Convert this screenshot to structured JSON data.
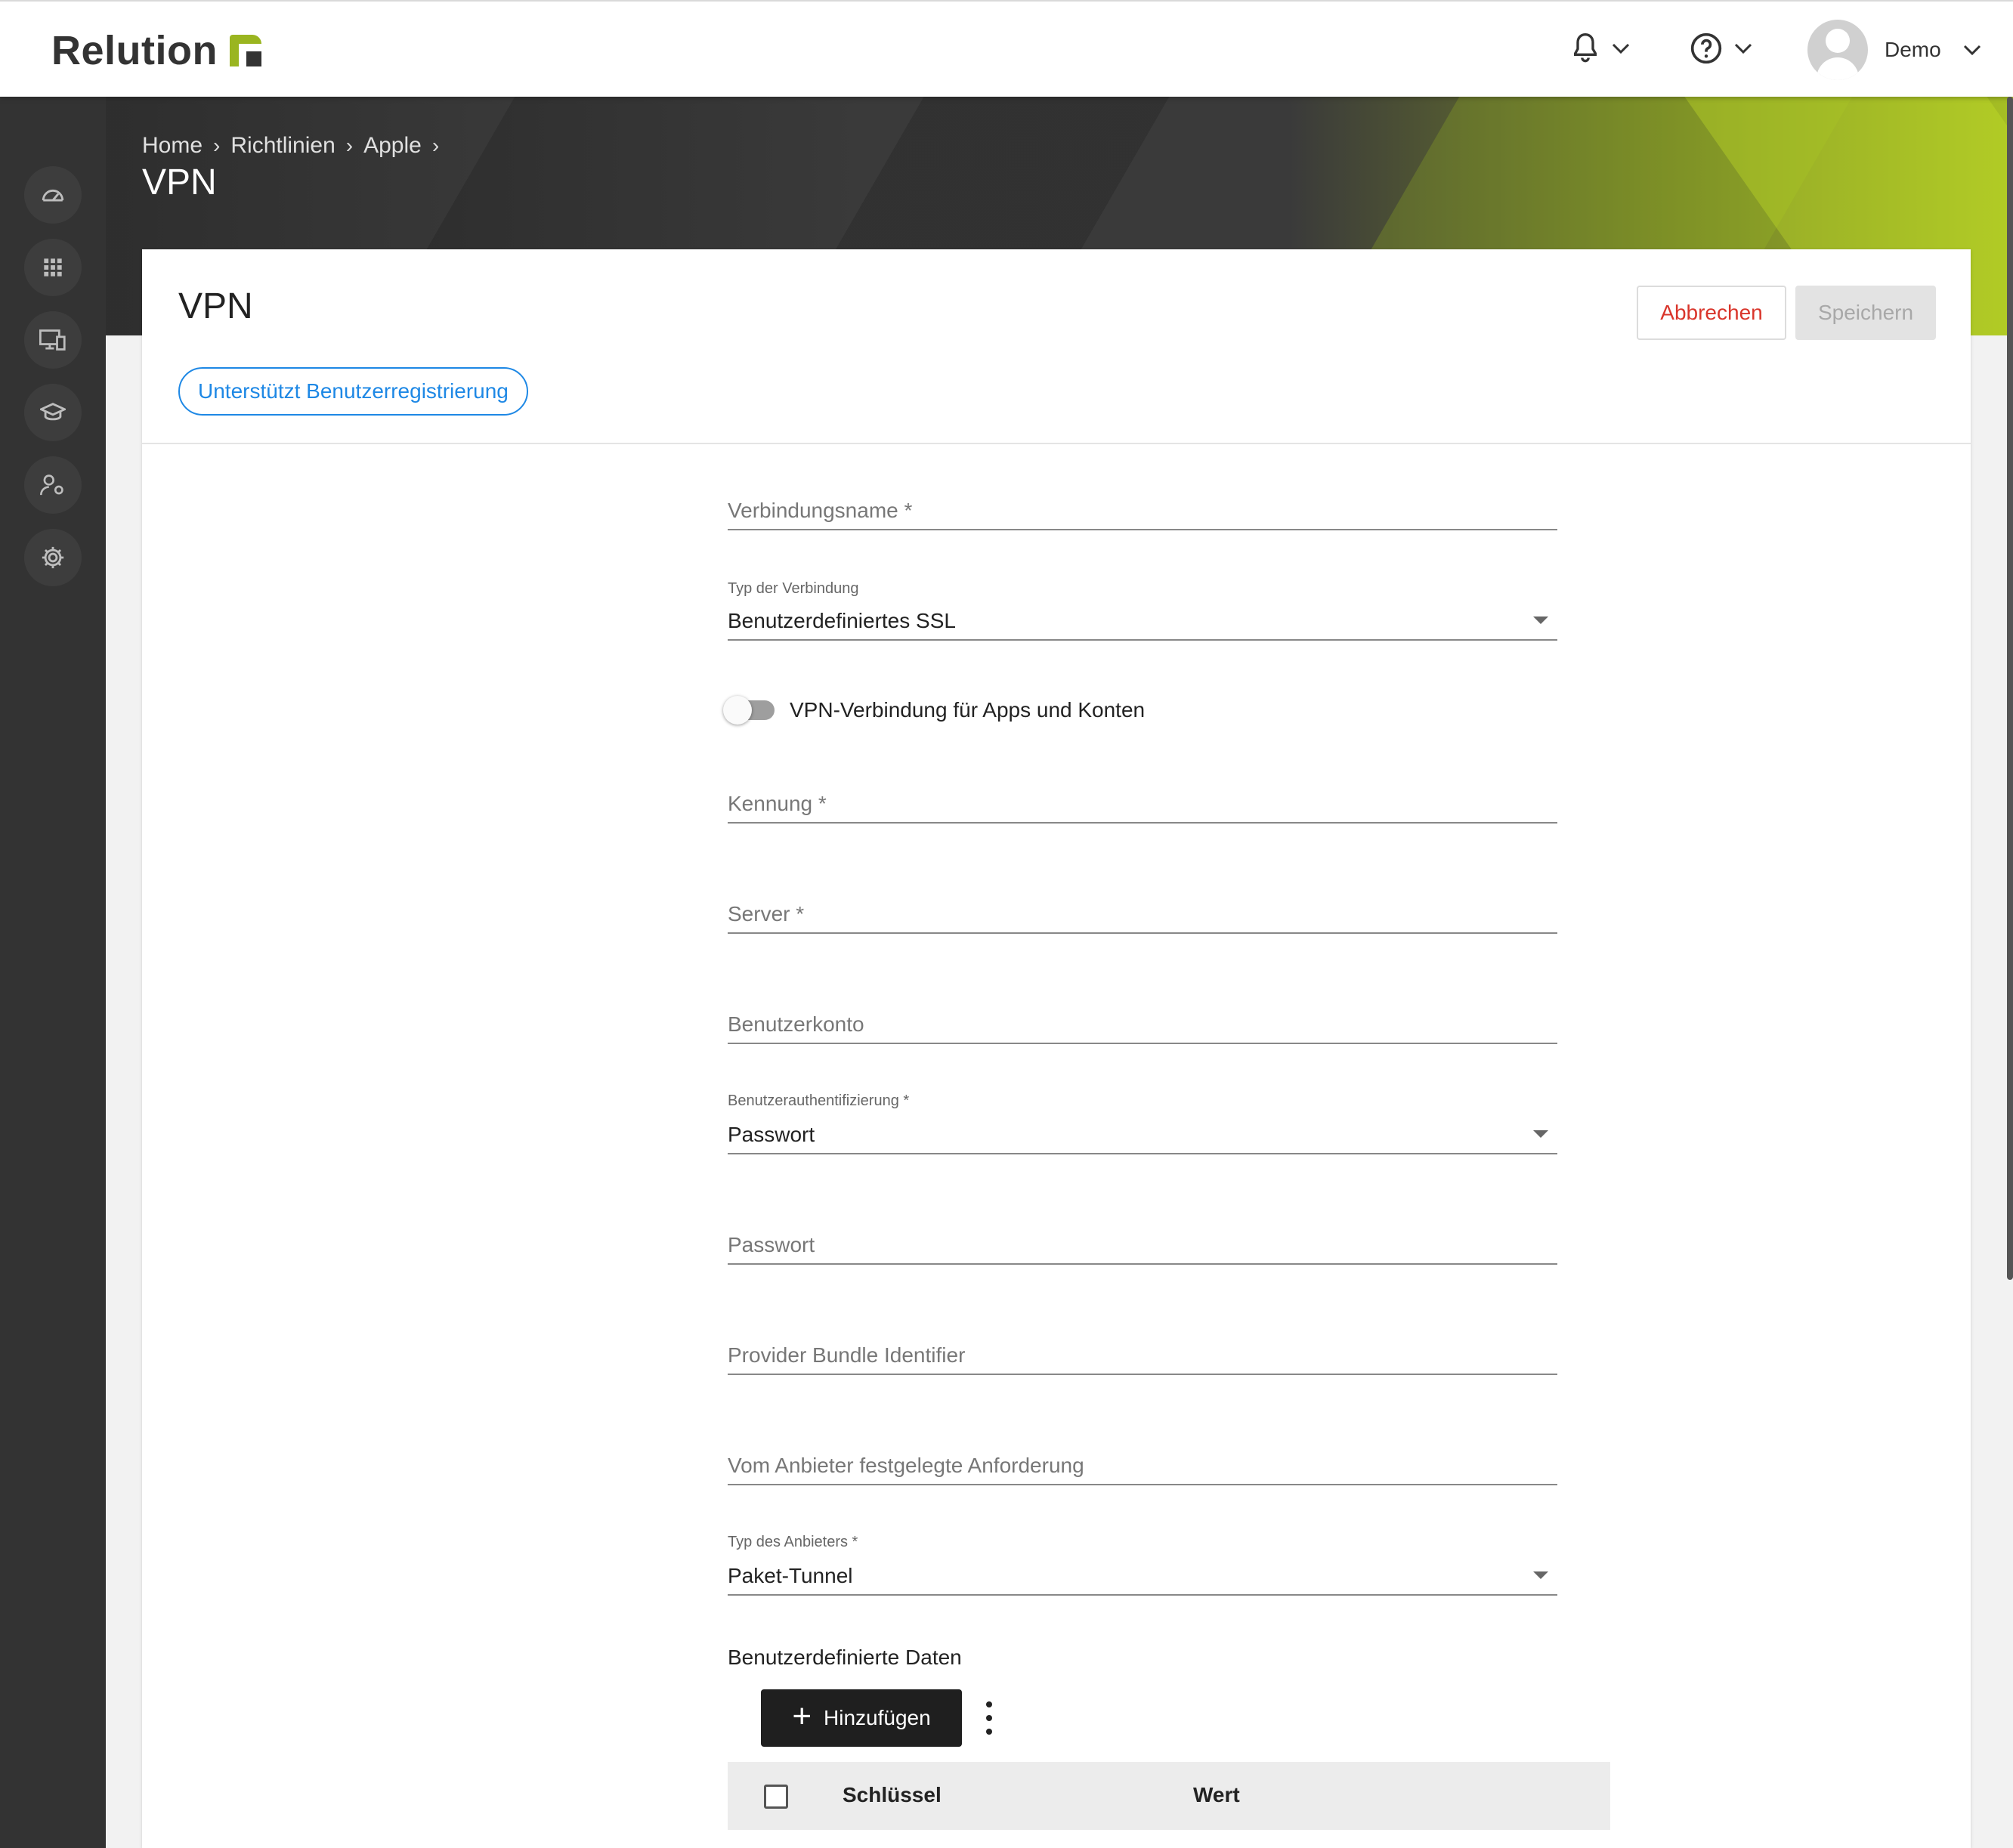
{
  "app": {
    "brand": "Relution",
    "user_name": "Demo",
    "colors": {
      "accent": "#9ab520",
      "link": "#1e88e5",
      "danger": "#d9352b",
      "dark": "#333333"
    }
  },
  "header_icons": [
    "bell-icon",
    "chevron-down-icon",
    "help-icon",
    "chevron-down-icon",
    "avatar",
    "chevron-down-icon"
  ],
  "sidebar": {
    "items": [
      {
        "name": "dashboard-icon"
      },
      {
        "name": "apps-grid-icon"
      },
      {
        "name": "devices-icon"
      },
      {
        "name": "education-icon"
      },
      {
        "name": "user-settings-icon"
      },
      {
        "name": "settings-gear-icon"
      }
    ]
  },
  "breadcrumb": [
    "Home",
    "Richtlinien",
    "Apple"
  ],
  "page_title": "VPN",
  "card": {
    "title": "VPN",
    "cancel_label": "Abbrechen",
    "save_label": "Speichern",
    "chip_label": "Unterstützt Benutzerregistrierung"
  },
  "form": {
    "connection_name": {
      "placeholder": "Verbindungsname *"
    },
    "connection_type": {
      "label": "Typ der Verbindung",
      "value": "Benutzerdefiniertes SSL"
    },
    "per_app_toggle": {
      "label": "VPN-Verbindung für Apps und Konten",
      "on": false
    },
    "identifier": {
      "placeholder": "Kennung *"
    },
    "server": {
      "placeholder": "Server *"
    },
    "account": {
      "placeholder": "Benutzerkonto"
    },
    "user_auth": {
      "label": "Benutzerauthentifizierung *",
      "value": "Passwort"
    },
    "password": {
      "placeholder": "Passwort"
    },
    "provider_bundle": {
      "placeholder": "Provider Bundle Identifier"
    },
    "provider_requirement": {
      "placeholder": "Vom Anbieter festgelegte Anforderung"
    },
    "provider_type": {
      "label": "Typ des Anbieters *",
      "value": "Paket-Tunnel"
    },
    "custom_data": {
      "label": "Benutzerdefinierte Daten",
      "add_label": "Hinzufügen",
      "columns": [
        "Schlüssel",
        "Wert"
      ]
    }
  }
}
